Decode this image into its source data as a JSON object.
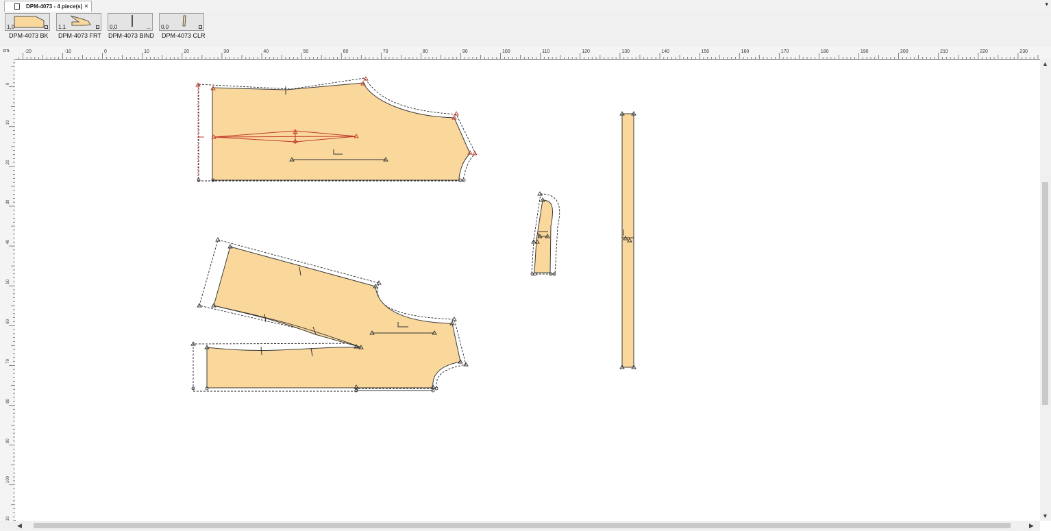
{
  "document_tab": {
    "title": "DPM-4073  -  4 piece(s)",
    "close": "×",
    "menu": "▾"
  },
  "pieces": [
    {
      "name": "DPM-4073 BK",
      "scale": "1,0"
    },
    {
      "name": "DPM-4073 FRT",
      "scale": "1,1"
    },
    {
      "name": "DPM-4073 BIND",
      "scale": "0,0"
    },
    {
      "name": "DPM-4073 CLR",
      "scale": "0,0"
    }
  ],
  "ruler": {
    "unit": "cm.",
    "h_labels": [
      "-20",
      "-10",
      "0",
      "10",
      "20",
      "30",
      "40",
      "50",
      "60",
      "70",
      "80",
      "90",
      "100",
      "110",
      "120",
      "130",
      "140",
      "150",
      "160",
      "170",
      "180",
      "190",
      "200",
      "210",
      "220",
      "230"
    ],
    "v_labels": [
      "0",
      "10",
      "20",
      "30",
      "40",
      "50",
      "60",
      "70",
      "80",
      "90",
      "100",
      "110"
    ]
  },
  "colors": {
    "piece_fill": "#fad79b",
    "selected": "#c0392b",
    "outline": "#3a3a3a",
    "seam": "#222222"
  },
  "scroll": {
    "up": "▲",
    "down": "▼",
    "left": "◀",
    "right": "▶"
  }
}
